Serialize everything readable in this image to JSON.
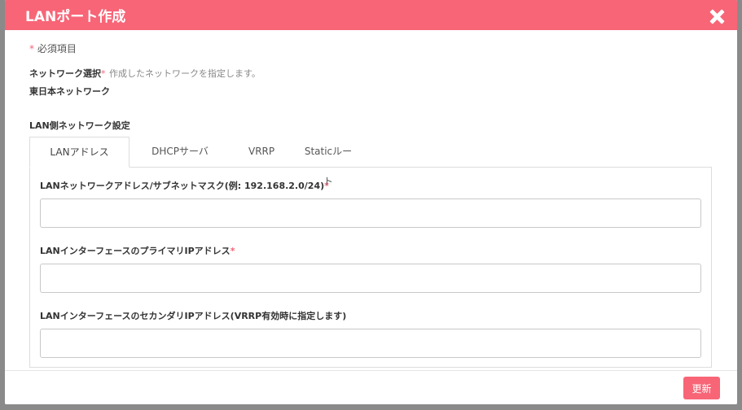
{
  "modal": {
    "title": "LANポート作成",
    "required_note": "必須項目",
    "asterisk": "*",
    "network": {
      "label": "ネットワーク選択",
      "hint": "作成したネットワークを指定します。",
      "value": "東日本ネットワーク"
    },
    "lan_settings_label": "LAN側ネットワーク設定",
    "tabs": [
      {
        "label": "LANアドレス",
        "active": true
      },
      {
        "label": "DHCPサーバ",
        "active": false
      },
      {
        "label": "VRRP",
        "active": false
      },
      {
        "label": "Staticルート",
        "active": false
      }
    ],
    "fields": [
      {
        "label": "LANネットワークアドレス/サブネットマスク(例: 192.168.2.0/24)",
        "required": true,
        "value": ""
      },
      {
        "label": "LANインターフェースのプライマリIPアドレス",
        "required": true,
        "value": ""
      },
      {
        "label": "LANインターフェースのセカンダリIPアドレス(VRRP有効時に指定します)",
        "required": false,
        "value": ""
      }
    ],
    "update_button": "更新"
  },
  "colors": {
    "accent": "#f76577"
  }
}
